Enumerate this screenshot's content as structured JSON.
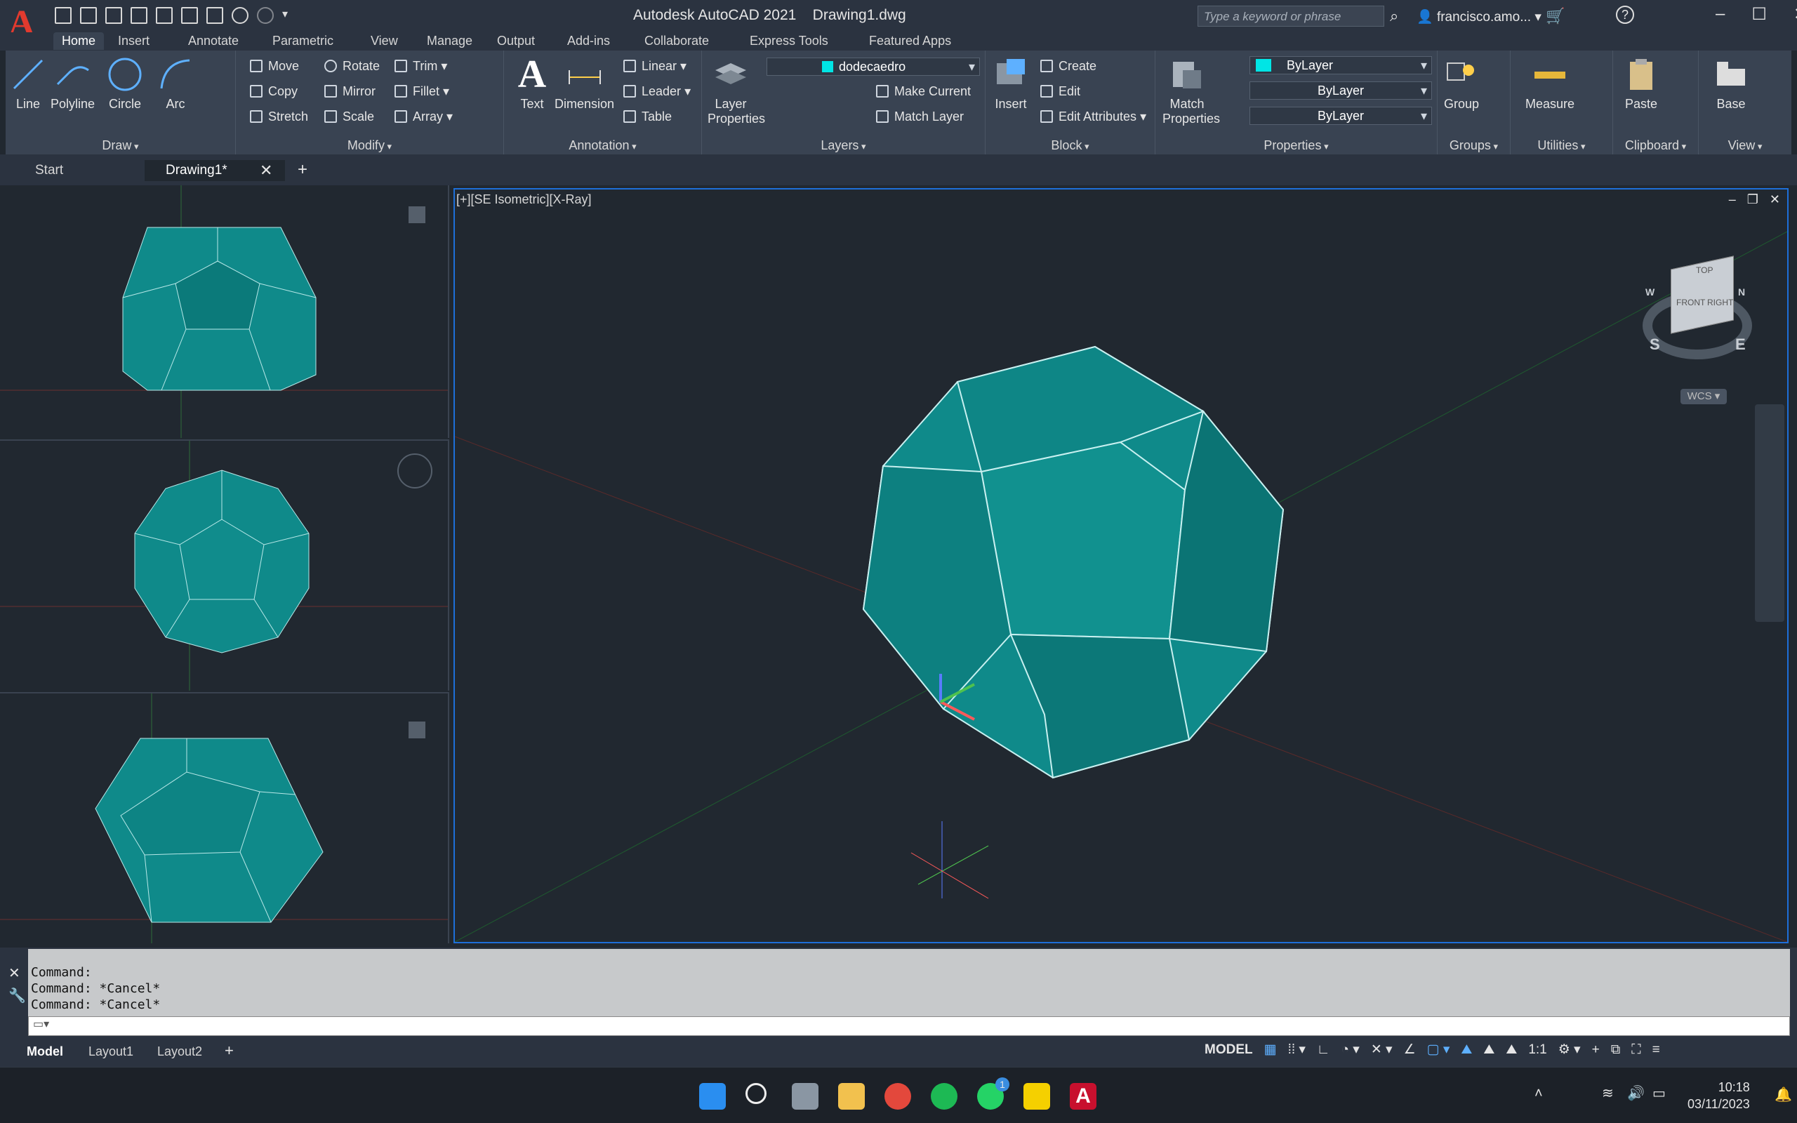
{
  "app": {
    "title": "Autodesk AutoCAD 2021",
    "file": "Drawing1.dwg",
    "search_placeholder": "Type a keyword or phrase",
    "user": "francisco.amo..."
  },
  "menu_tabs": [
    "Home",
    "Insert",
    "Annotate",
    "Parametric",
    "View",
    "Manage",
    "Output",
    "Add-ins",
    "Collaborate",
    "Express Tools",
    "Featured Apps"
  ],
  "ribbon": {
    "draw": {
      "title": "Draw",
      "line": "Line",
      "polyline": "Polyline",
      "circle": "Circle",
      "arc": "Arc"
    },
    "modify": {
      "title": "Modify",
      "move": "Move",
      "rotate": "Rotate",
      "trim": "Trim",
      "copy": "Copy",
      "mirror": "Mirror",
      "fillet": "Fillet",
      "stretch": "Stretch",
      "scale": "Scale",
      "array": "Array"
    },
    "annotation": {
      "title": "Annotation",
      "text": "Text",
      "dimension": "Dimension",
      "linear": "Linear",
      "leader": "Leader",
      "table": "Table"
    },
    "layers": {
      "title": "Layers",
      "layer_properties": "Layer Properties",
      "current_layer": "dodecaedro",
      "make_current": "Make Current",
      "match_layer": "Match Layer"
    },
    "block": {
      "title": "Block",
      "insert": "Insert",
      "create": "Create",
      "edit": "Edit",
      "edit_attributes": "Edit Attributes"
    },
    "properties": {
      "title": "Properties",
      "match_properties": "Match Properties",
      "color": "ByLayer",
      "linetype": "ByLayer",
      "lineweight": "ByLayer"
    },
    "groups": {
      "title": "Groups",
      "group": "Group"
    },
    "utilities": {
      "title": "Utilities",
      "measure": "Measure"
    },
    "clipboard": {
      "title": "Clipboard",
      "paste": "Paste"
    },
    "view": {
      "title": "View",
      "base": "Base"
    }
  },
  "doc_tabs": {
    "start": "Start",
    "drawing": "Drawing1*"
  },
  "viewport": {
    "label": "[+][SE Isometric][X-Ray]",
    "viewcube_top": "TOP",
    "viewcube_front": "FRONT",
    "viewcube_right": "RIGHT",
    "wcs": "WCS",
    "compass_s": "S",
    "compass_e": "E",
    "compass_n": "N",
    "compass_w": "W"
  },
  "command": {
    "lines": [
      "Command:",
      "Command: *Cancel*",
      "Command: *Cancel*"
    ]
  },
  "layouts": {
    "model": "Model",
    "layout1": "Layout1",
    "layout2": "Layout2"
  },
  "status": {
    "model": "MODEL",
    "scale": "1:1"
  },
  "taskbar": {
    "time": "10:18",
    "date": "03/11/2023",
    "badge": "1"
  },
  "colors": {
    "solid": "#0f8a8a",
    "solid_dark": "#0b6e70",
    "accent": "#1e6fd9",
    "brand": "#e23a2e"
  }
}
